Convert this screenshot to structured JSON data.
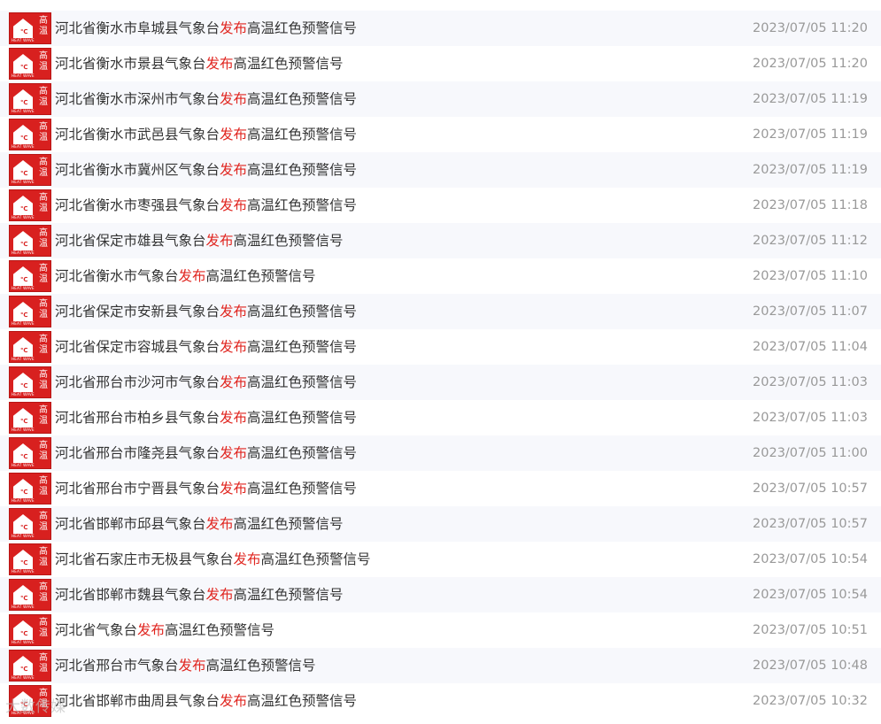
{
  "icon": {
    "line1": "高",
    "line2": "温",
    "degree": "℃",
    "caption": "HEAT WAVE",
    "color": "#d8201f"
  },
  "highlight_color": "#e0251f",
  "watermark": "大数传媒",
  "items": [
    {
      "pre": "河北省衡水市阜城县气象台",
      "hl": "发布",
      "post": "高温红色预警信号",
      "time": "2023/07/05 11:20"
    },
    {
      "pre": "河北省衡水市景县气象台",
      "hl": "发布",
      "post": "高温红色预警信号",
      "time": "2023/07/05 11:20"
    },
    {
      "pre": "河北省衡水市深州市气象台",
      "hl": "发布",
      "post": "高温红色预警信号",
      "time": "2023/07/05 11:19"
    },
    {
      "pre": "河北省衡水市武邑县气象台",
      "hl": "发布",
      "post": "高温红色预警信号",
      "time": "2023/07/05 11:19"
    },
    {
      "pre": "河北省衡水市冀州区气象台",
      "hl": "发布",
      "post": "高温红色预警信号",
      "time": "2023/07/05 11:19"
    },
    {
      "pre": "河北省衡水市枣强县气象台",
      "hl": "发布",
      "post": "高温红色预警信号",
      "time": "2023/07/05 11:18"
    },
    {
      "pre": "河北省保定市雄县气象台",
      "hl": "发布",
      "post": "高温红色预警信号",
      "time": "2023/07/05 11:12"
    },
    {
      "pre": "河北省衡水市气象台",
      "hl": "发布",
      "post": "高温红色预警信号",
      "time": "2023/07/05 11:10"
    },
    {
      "pre": "河北省保定市安新县气象台",
      "hl": "发布",
      "post": "高温红色预警信号",
      "time": "2023/07/05 11:07"
    },
    {
      "pre": "河北省保定市容城县气象台",
      "hl": "发布",
      "post": "高温红色预警信号",
      "time": "2023/07/05 11:04"
    },
    {
      "pre": "河北省邢台市沙河市气象台",
      "hl": "发布",
      "post": "高温红色预警信号",
      "time": "2023/07/05 11:03"
    },
    {
      "pre": "河北省邢台市柏乡县气象台",
      "hl": "发布",
      "post": "高温红色预警信号",
      "time": "2023/07/05 11:03"
    },
    {
      "pre": "河北省邢台市隆尧县气象台",
      "hl": "发布",
      "post": "高温红色预警信号",
      "time": "2023/07/05 11:00"
    },
    {
      "pre": "河北省邢台市宁晋县气象台",
      "hl": "发布",
      "post": "高温红色预警信号",
      "time": "2023/07/05 10:57"
    },
    {
      "pre": "河北省邯郸市邱县气象台",
      "hl": "发布",
      "post": "高温红色预警信号",
      "time": "2023/07/05 10:57"
    },
    {
      "pre": "河北省石家庄市无极县气象台",
      "hl": "发布",
      "post": "高温红色预警信号",
      "time": "2023/07/05 10:54"
    },
    {
      "pre": "河北省邯郸市魏县气象台",
      "hl": "发布",
      "post": "高温红色预警信号",
      "time": "2023/07/05 10:54"
    },
    {
      "pre": "河北省气象台",
      "hl": "发布",
      "post": "高温红色预警信号",
      "time": "2023/07/05 10:51"
    },
    {
      "pre": "河北省邢台市气象台",
      "hl": "发布",
      "post": "高温红色预警信号",
      "time": "2023/07/05 10:48"
    },
    {
      "pre": "河北省邯郸市曲周县气象台",
      "hl": "发布",
      "post": "高温红色预警信号",
      "time": "2023/07/05 10:32"
    }
  ]
}
